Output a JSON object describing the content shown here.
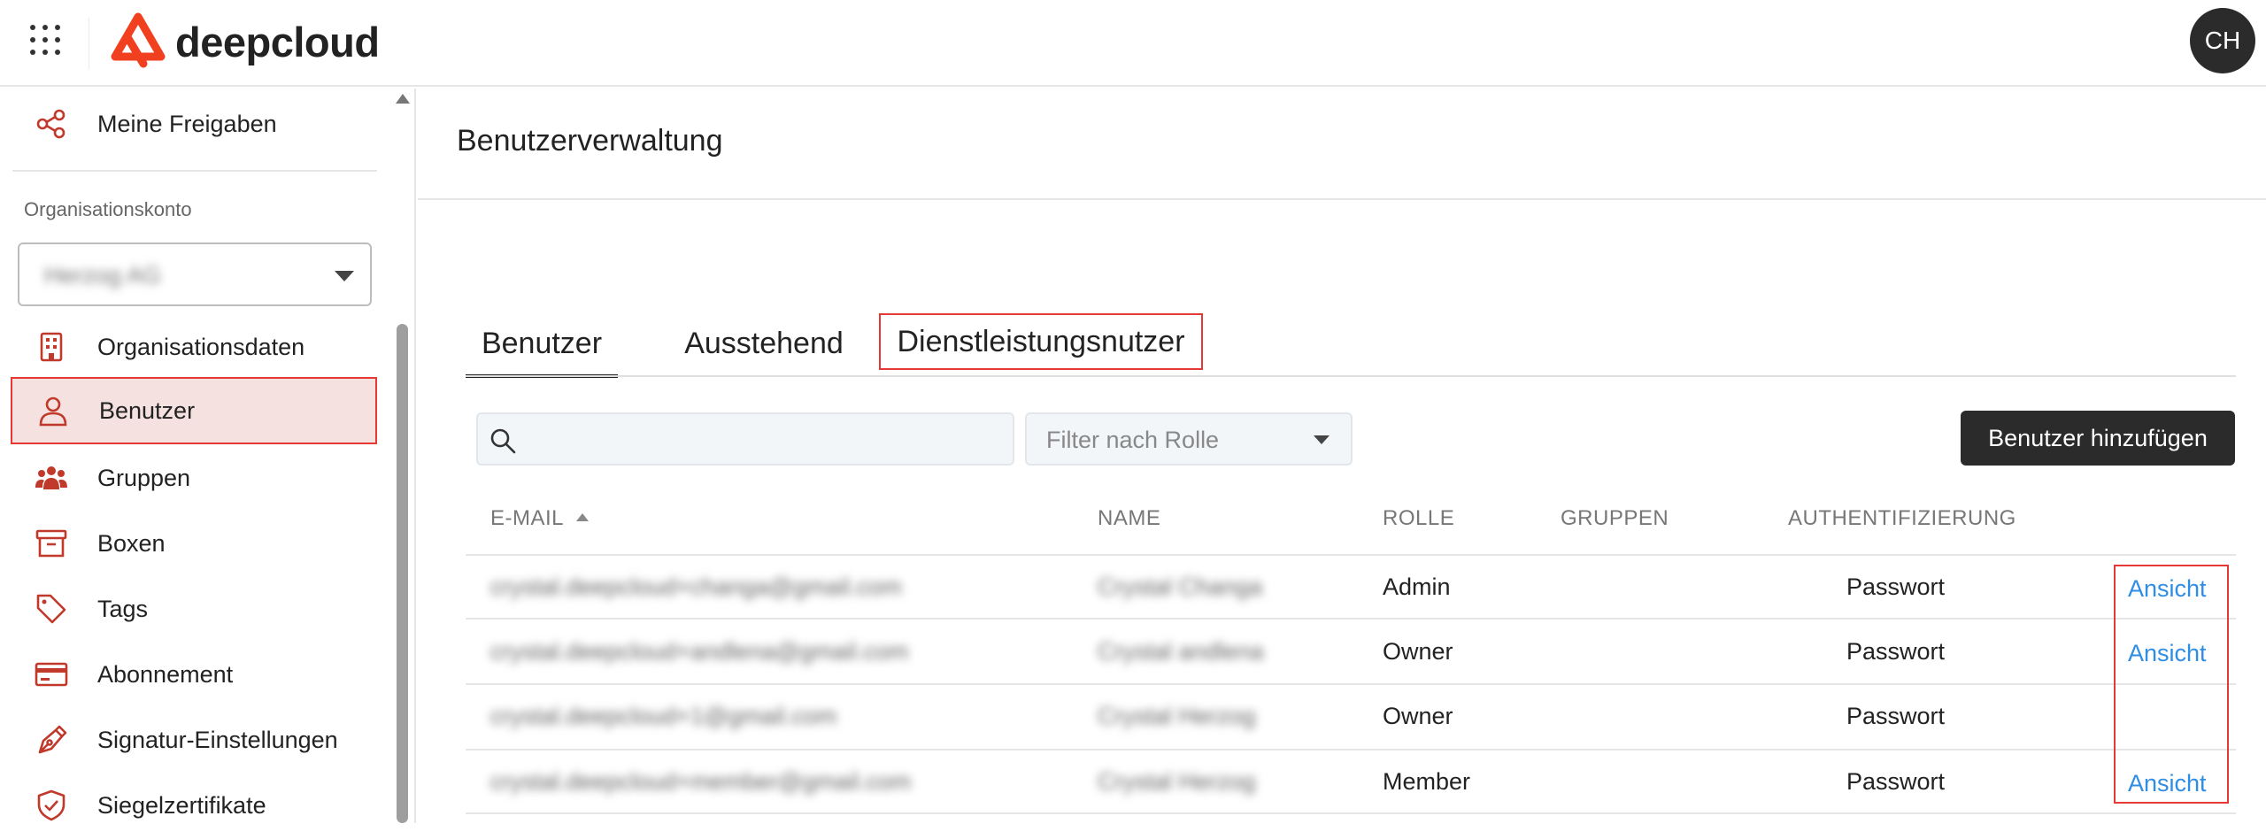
{
  "header": {
    "logo_text": "deepcloud",
    "avatar_initials": "CH",
    "brand_color": "#f0401f"
  },
  "sidebar": {
    "top_item": {
      "label": "Meine Freigaben",
      "icon": "share-icon"
    },
    "section_label": "Organisationskonto",
    "org_select_value": "Herzog AG",
    "items": [
      {
        "label": "Organisationsdaten",
        "icon": "building-icon"
      },
      {
        "label": "Benutzer",
        "icon": "user-icon",
        "active": true
      },
      {
        "label": "Gruppen",
        "icon": "group-icon"
      },
      {
        "label": "Boxen",
        "icon": "archive-box-icon"
      },
      {
        "label": "Tags",
        "icon": "tag-icon"
      },
      {
        "label": "Abonnement",
        "icon": "credit-card-icon"
      },
      {
        "label": "Signatur-Einstellungen",
        "icon": "pen-nib-icon"
      },
      {
        "label": "Siegelzertifikate",
        "icon": "shield-check-icon"
      }
    ]
  },
  "main": {
    "title": "Benutzerverwaltung",
    "tabs": [
      {
        "label": "Benutzer",
        "active": true
      },
      {
        "label": "Ausstehend"
      },
      {
        "label": "Dienstleistungsnutzer"
      }
    ],
    "search_value": "",
    "filter_placeholder": "Filter nach Rolle",
    "add_button": "Benutzer hinzufügen",
    "columns": {
      "email": "E-MAIL",
      "name": "NAME",
      "role": "ROLLE",
      "groups": "GRUPPEN",
      "auth": "AUTHENTIFIZIERUNG"
    },
    "rows": [
      {
        "email": "crystal.deepcloud+changa@gmail.com",
        "name": "Crystal Changa",
        "role": "Admin",
        "groups": "",
        "auth": "Passwort",
        "action": "Ansicht"
      },
      {
        "email": "crystal.deepcloud+andlena@gmail.com",
        "name": "Crystal andlena",
        "role": "Owner",
        "groups": "",
        "auth": "Passwort",
        "action": "Ansicht"
      },
      {
        "email": "crystal.deepcloud+1@gmail.com",
        "name": "Crystal Herzog",
        "role": "Owner",
        "groups": "",
        "auth": "Passwort",
        "action": ""
      },
      {
        "email": "crystal.deepcloud+member@gmail.com",
        "name": "Crystal Herzog",
        "role": "Member",
        "groups": "",
        "auth": "Passwort",
        "action": "Ansicht"
      }
    ]
  }
}
